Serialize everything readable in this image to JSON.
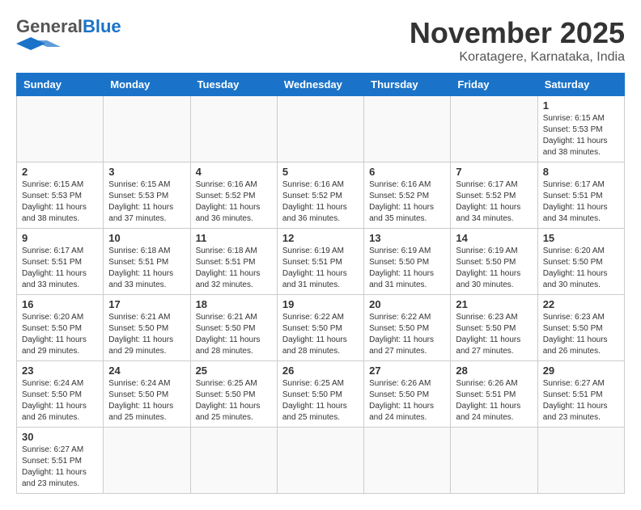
{
  "header": {
    "logo_general": "General",
    "logo_blue": "Blue",
    "month_year": "November 2025",
    "location": "Koratagere, Karnataka, India"
  },
  "days_of_week": [
    "Sunday",
    "Monday",
    "Tuesday",
    "Wednesday",
    "Thursday",
    "Friday",
    "Saturday"
  ],
  "weeks": [
    [
      {
        "day": "",
        "info": ""
      },
      {
        "day": "",
        "info": ""
      },
      {
        "day": "",
        "info": ""
      },
      {
        "day": "",
        "info": ""
      },
      {
        "day": "",
        "info": ""
      },
      {
        "day": "",
        "info": ""
      },
      {
        "day": "1",
        "info": "Sunrise: 6:15 AM\nSunset: 5:53 PM\nDaylight: 11 hours\nand 38 minutes."
      }
    ],
    [
      {
        "day": "2",
        "info": "Sunrise: 6:15 AM\nSunset: 5:53 PM\nDaylight: 11 hours\nand 38 minutes."
      },
      {
        "day": "3",
        "info": "Sunrise: 6:15 AM\nSunset: 5:53 PM\nDaylight: 11 hours\nand 37 minutes."
      },
      {
        "day": "4",
        "info": "Sunrise: 6:16 AM\nSunset: 5:52 PM\nDaylight: 11 hours\nand 36 minutes."
      },
      {
        "day": "5",
        "info": "Sunrise: 6:16 AM\nSunset: 5:52 PM\nDaylight: 11 hours\nand 36 minutes."
      },
      {
        "day": "6",
        "info": "Sunrise: 6:16 AM\nSunset: 5:52 PM\nDaylight: 11 hours\nand 35 minutes."
      },
      {
        "day": "7",
        "info": "Sunrise: 6:17 AM\nSunset: 5:52 PM\nDaylight: 11 hours\nand 34 minutes."
      },
      {
        "day": "8",
        "info": "Sunrise: 6:17 AM\nSunset: 5:51 PM\nDaylight: 11 hours\nand 34 minutes."
      }
    ],
    [
      {
        "day": "9",
        "info": "Sunrise: 6:17 AM\nSunset: 5:51 PM\nDaylight: 11 hours\nand 33 minutes."
      },
      {
        "day": "10",
        "info": "Sunrise: 6:18 AM\nSunset: 5:51 PM\nDaylight: 11 hours\nand 33 minutes."
      },
      {
        "day": "11",
        "info": "Sunrise: 6:18 AM\nSunset: 5:51 PM\nDaylight: 11 hours\nand 32 minutes."
      },
      {
        "day": "12",
        "info": "Sunrise: 6:19 AM\nSunset: 5:51 PM\nDaylight: 11 hours\nand 31 minutes."
      },
      {
        "day": "13",
        "info": "Sunrise: 6:19 AM\nSunset: 5:50 PM\nDaylight: 11 hours\nand 31 minutes."
      },
      {
        "day": "14",
        "info": "Sunrise: 6:19 AM\nSunset: 5:50 PM\nDaylight: 11 hours\nand 30 minutes."
      },
      {
        "day": "15",
        "info": "Sunrise: 6:20 AM\nSunset: 5:50 PM\nDaylight: 11 hours\nand 30 minutes."
      }
    ],
    [
      {
        "day": "16",
        "info": "Sunrise: 6:20 AM\nSunset: 5:50 PM\nDaylight: 11 hours\nand 29 minutes."
      },
      {
        "day": "17",
        "info": "Sunrise: 6:21 AM\nSunset: 5:50 PM\nDaylight: 11 hours\nand 29 minutes."
      },
      {
        "day": "18",
        "info": "Sunrise: 6:21 AM\nSunset: 5:50 PM\nDaylight: 11 hours\nand 28 minutes."
      },
      {
        "day": "19",
        "info": "Sunrise: 6:22 AM\nSunset: 5:50 PM\nDaylight: 11 hours\nand 28 minutes."
      },
      {
        "day": "20",
        "info": "Sunrise: 6:22 AM\nSunset: 5:50 PM\nDaylight: 11 hours\nand 27 minutes."
      },
      {
        "day": "21",
        "info": "Sunrise: 6:23 AM\nSunset: 5:50 PM\nDaylight: 11 hours\nand 27 minutes."
      },
      {
        "day": "22",
        "info": "Sunrise: 6:23 AM\nSunset: 5:50 PM\nDaylight: 11 hours\nand 26 minutes."
      }
    ],
    [
      {
        "day": "23",
        "info": "Sunrise: 6:24 AM\nSunset: 5:50 PM\nDaylight: 11 hours\nand 26 minutes."
      },
      {
        "day": "24",
        "info": "Sunrise: 6:24 AM\nSunset: 5:50 PM\nDaylight: 11 hours\nand 25 minutes."
      },
      {
        "day": "25",
        "info": "Sunrise: 6:25 AM\nSunset: 5:50 PM\nDaylight: 11 hours\nand 25 minutes."
      },
      {
        "day": "26",
        "info": "Sunrise: 6:25 AM\nSunset: 5:50 PM\nDaylight: 11 hours\nand 25 minutes."
      },
      {
        "day": "27",
        "info": "Sunrise: 6:26 AM\nSunset: 5:50 PM\nDaylight: 11 hours\nand 24 minutes."
      },
      {
        "day": "28",
        "info": "Sunrise: 6:26 AM\nSunset: 5:51 PM\nDaylight: 11 hours\nand 24 minutes."
      },
      {
        "day": "29",
        "info": "Sunrise: 6:27 AM\nSunset: 5:51 PM\nDaylight: 11 hours\nand 23 minutes."
      }
    ],
    [
      {
        "day": "30",
        "info": "Sunrise: 6:27 AM\nSunset: 5:51 PM\nDaylight: 11 hours\nand 23 minutes."
      },
      {
        "day": "",
        "info": ""
      },
      {
        "day": "",
        "info": ""
      },
      {
        "day": "",
        "info": ""
      },
      {
        "day": "",
        "info": ""
      },
      {
        "day": "",
        "info": ""
      },
      {
        "day": "",
        "info": ""
      }
    ]
  ]
}
